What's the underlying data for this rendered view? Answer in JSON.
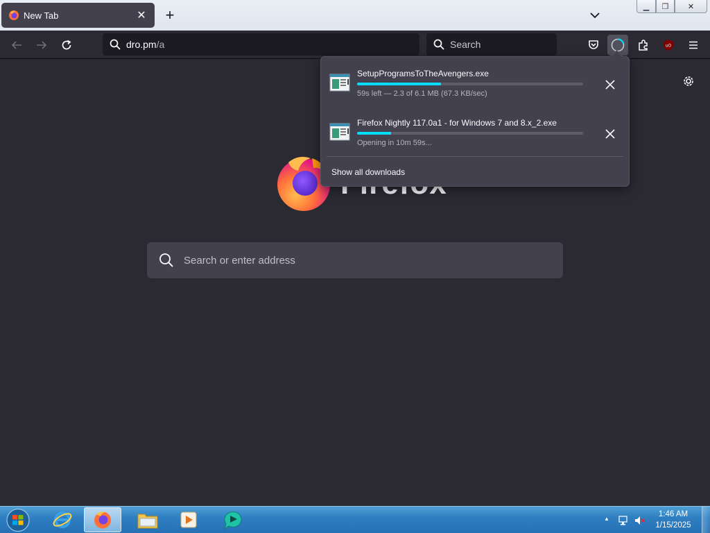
{
  "tab": {
    "title": "New Tab",
    "close_glyph": "✕",
    "favicon": "firefox-icon"
  },
  "newtab": {
    "glyph": "+"
  },
  "window_controls": {
    "minimize": "▁",
    "maximize": "❐",
    "close": "✕"
  },
  "toolbar": {
    "url_host": "dro.pm",
    "url_path": "/a",
    "search_label": "Search",
    "icons": [
      "back-arrow-icon",
      "forward-arrow-icon",
      "reload-icon",
      "pocket-icon",
      "downloads-icon",
      "extensions-icon",
      "ublock-icon",
      "menu-icon"
    ]
  },
  "content": {
    "logo_word": "Firefox",
    "search_placeholder": "Search or enter address"
  },
  "downloads": {
    "items": [
      {
        "name": "SetupProgramsToTheAvengers.exe",
        "status": "59s left — 2.3 of 6.1 MB (67.3 KB/sec)",
        "progress_percent": 37
      },
      {
        "name": "Firefox Nightly 117.0a1 - for Windows 7 and 8.x_2.exe",
        "status": "Opening in 10m 59s...",
        "progress_percent": 15
      }
    ],
    "show_all": "Show all downloads"
  },
  "taskbar": {
    "apps": [
      "internet-explorer-icon",
      "firefox-icon",
      "file-explorer-icon",
      "media-player-icon",
      "chat-app-icon"
    ],
    "clock_time": "1:46 AM",
    "clock_date": "1/15/2025",
    "tray_expand": "▲"
  },
  "colors": {
    "accent": "#00ddff",
    "toolbar": "#2b2a33",
    "panel": "#42414d"
  }
}
